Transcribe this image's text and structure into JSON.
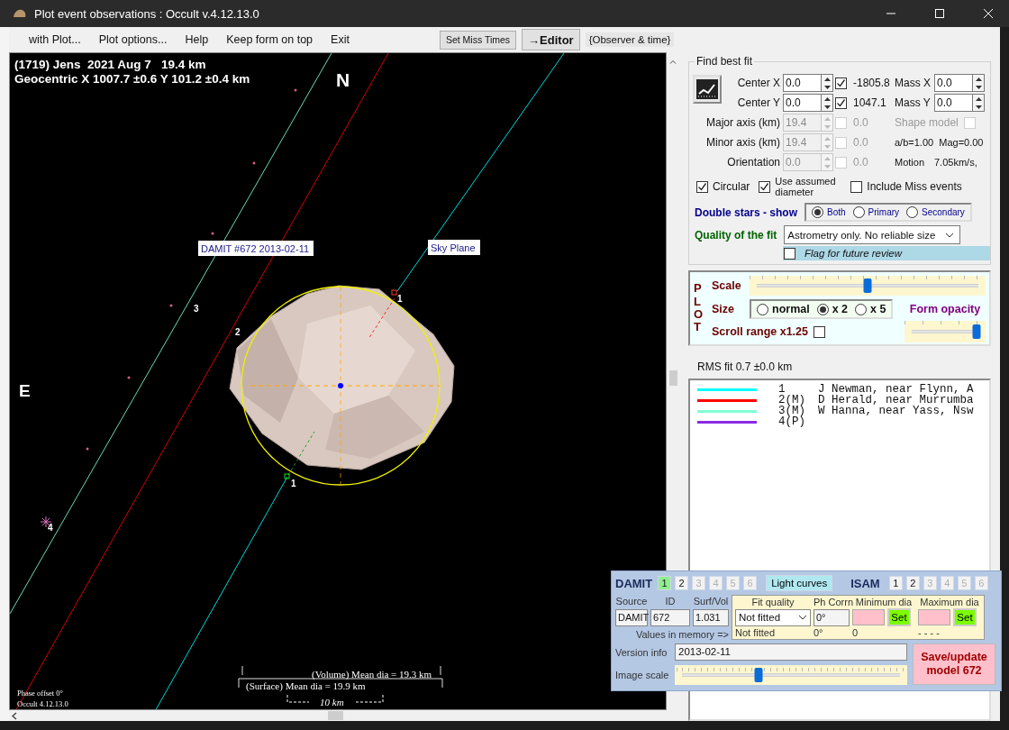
{
  "window": {
    "title": "Plot event observations : Occult v.4.12.13.0"
  },
  "menu": [
    {
      "label": "with Plot...",
      "kind": "menu"
    },
    {
      "label": "Plot options...",
      "kind": "menu"
    },
    {
      "label": "Help",
      "kind": "menu"
    },
    {
      "label": "Keep form on top",
      "kind": "menu"
    },
    {
      "label": "Exit",
      "kind": "menu"
    },
    {
      "label": "Set Miss Times",
      "kind": "button"
    },
    {
      "label": "→Editor",
      "kind": "strong"
    },
    {
      "label": "{Observer & time}",
      "kind": "tag"
    }
  ],
  "plot": {
    "title": "(1719) Jens  2021 Aug 7   19.4 km",
    "subtitle": "Geocentric X 1007.7 ±0.6 Y 101.2 ±0.4 km",
    "north": "N",
    "east": "E",
    "model_label": "DAMIT #672 2013-02-11",
    "sky_plane": "Sky Plane",
    "markers": [
      {
        "label": "1"
      },
      {
        "label": "1"
      },
      {
        "label": "2"
      },
      {
        "label": "3"
      },
      {
        "label": "4"
      }
    ],
    "volume_dia": "(Volume) Mean dia = 19.3 km",
    "surface_dia": "(Surface) Mean dia = 19.9 km",
    "scale_bar": "10 km",
    "phase_offset": "Phase offset 0°",
    "version": "Occult 4.12.13.0"
  },
  "fit": {
    "legend": "Find best fit",
    "center": [
      {
        "label": "Center X",
        "value": "0.0",
        "checked": true,
        "result": "-1805.8",
        "mass_label": "Mass X",
        "mass_value": "0.0"
      },
      {
        "label": "Center Y",
        "value": "0.0",
        "checked": true,
        "result": "1047.1",
        "mass_label": "Mass Y",
        "mass_value": "0.0"
      }
    ],
    "shape": [
      {
        "label": "Major axis (km)",
        "value": "19.4",
        "checked": false,
        "result": "0.0"
      },
      {
        "label": "Minor axis (km)",
        "value": "19.4",
        "checked": false,
        "result": "0.0"
      },
      {
        "label": "Orientation",
        "value": "0.0",
        "checked": false,
        "result": "0.0"
      }
    ],
    "shape_model": {
      "label": "Shape model",
      "checked": false
    },
    "ratio": "a/b=1.00  Mag=0.00",
    "motion_label": "Motion",
    "motion": "7.05km/s,",
    "options": [
      {
        "label": "Circular",
        "checked": true
      },
      {
        "label": "Use assumed diameter",
        "checked": true
      },
      {
        "label": "Include Miss events",
        "checked": false
      }
    ],
    "double_stars": {
      "label": "Double stars - show",
      "options": [
        {
          "label": "Both",
          "selected": true
        },
        {
          "label": "Primary",
          "selected": false
        },
        {
          "label": "Secondary",
          "selected": false
        }
      ]
    },
    "quality": {
      "label": "Quality of the fit",
      "value": "Astrometry only. No reliable size"
    },
    "flag": {
      "label": "Flag for future review",
      "checked": false
    }
  },
  "plot_controls": {
    "title": "PLOT",
    "scale_label": "Scale",
    "scale": {
      "level": 0.5
    },
    "size_label": "Size",
    "sizes": [
      {
        "label": "normal",
        "selected": false
      },
      {
        "label": "x 2",
        "selected": true
      },
      {
        "label": "x 5",
        "selected": false
      }
    ],
    "opacity_label": "Form opacity",
    "opacity": {
      "level": 0.97
    },
    "scroll_label": "Scroll range x1.25",
    "scroll_checked": false
  },
  "rms": "RMS fit 0.7 ±0.0 km",
  "observers": [
    {
      "color": "#00ffff",
      "number": "1",
      "name": "J Newman, near Flynn, A"
    },
    {
      "color": "#ff0000",
      "number": "2(M)",
      "name": "D Herald, near Murrumba"
    },
    {
      "color": "#80ffd4",
      "number": "3(M)",
      "name": "W Hanna, near Yass, Nsw"
    },
    {
      "color": "#8a2be2",
      "number": "4(P)"
    }
  ],
  "damit": {
    "title": "DAMIT",
    "models": [
      {
        "label": "1",
        "selected": true,
        "disabled": false
      },
      {
        "label": "2",
        "selected": false,
        "disabled": false
      },
      {
        "label": "3",
        "selected": false,
        "disabled": true
      },
      {
        "label": "4",
        "selected": false,
        "disabled": true
      },
      {
        "label": "5",
        "selected": false,
        "disabled": true
      },
      {
        "label": "6",
        "selected": false,
        "disabled": true
      }
    ],
    "light_curves": "Light curves",
    "isam_title": "ISAM",
    "isam_models": [
      {
        "label": "1",
        "selected": false,
        "disabled": false
      },
      {
        "label": "2",
        "selected": false,
        "disabled": false
      },
      {
        "label": "3",
        "selected": false,
        "disabled": true
      },
      {
        "label": "4",
        "selected": false,
        "disabled": true
      },
      {
        "label": "5",
        "selected": false,
        "disabled": true
      },
      {
        "label": "6",
        "selected": false,
        "disabled": true
      }
    ],
    "source_label": "Source",
    "id_label": "ID",
    "surf_label": "Surf/Vol",
    "source": "DAMIT",
    "id": "672",
    "surf": "1.031",
    "memory_label": "Values in memory =>",
    "fit_quality_label": "Fit quality",
    "fit_quality": "Not fitted",
    "ph_corr_label": "Ph Corrn",
    "ph_corr": "0°",
    "min_dia_label": "Minimum dia",
    "max_dia_label": "Maximum dia",
    "set_buttons": [
      "Set",
      "Set"
    ],
    "memory": [
      "Not fitted",
      "0°",
      "0",
      "- - - -"
    ],
    "version_label": "Version info",
    "version": "2013-02-11",
    "image_scale_label": "Image scale",
    "image_scale": {
      "level": 0.35
    },
    "save": "Save/update model 672"
  }
}
